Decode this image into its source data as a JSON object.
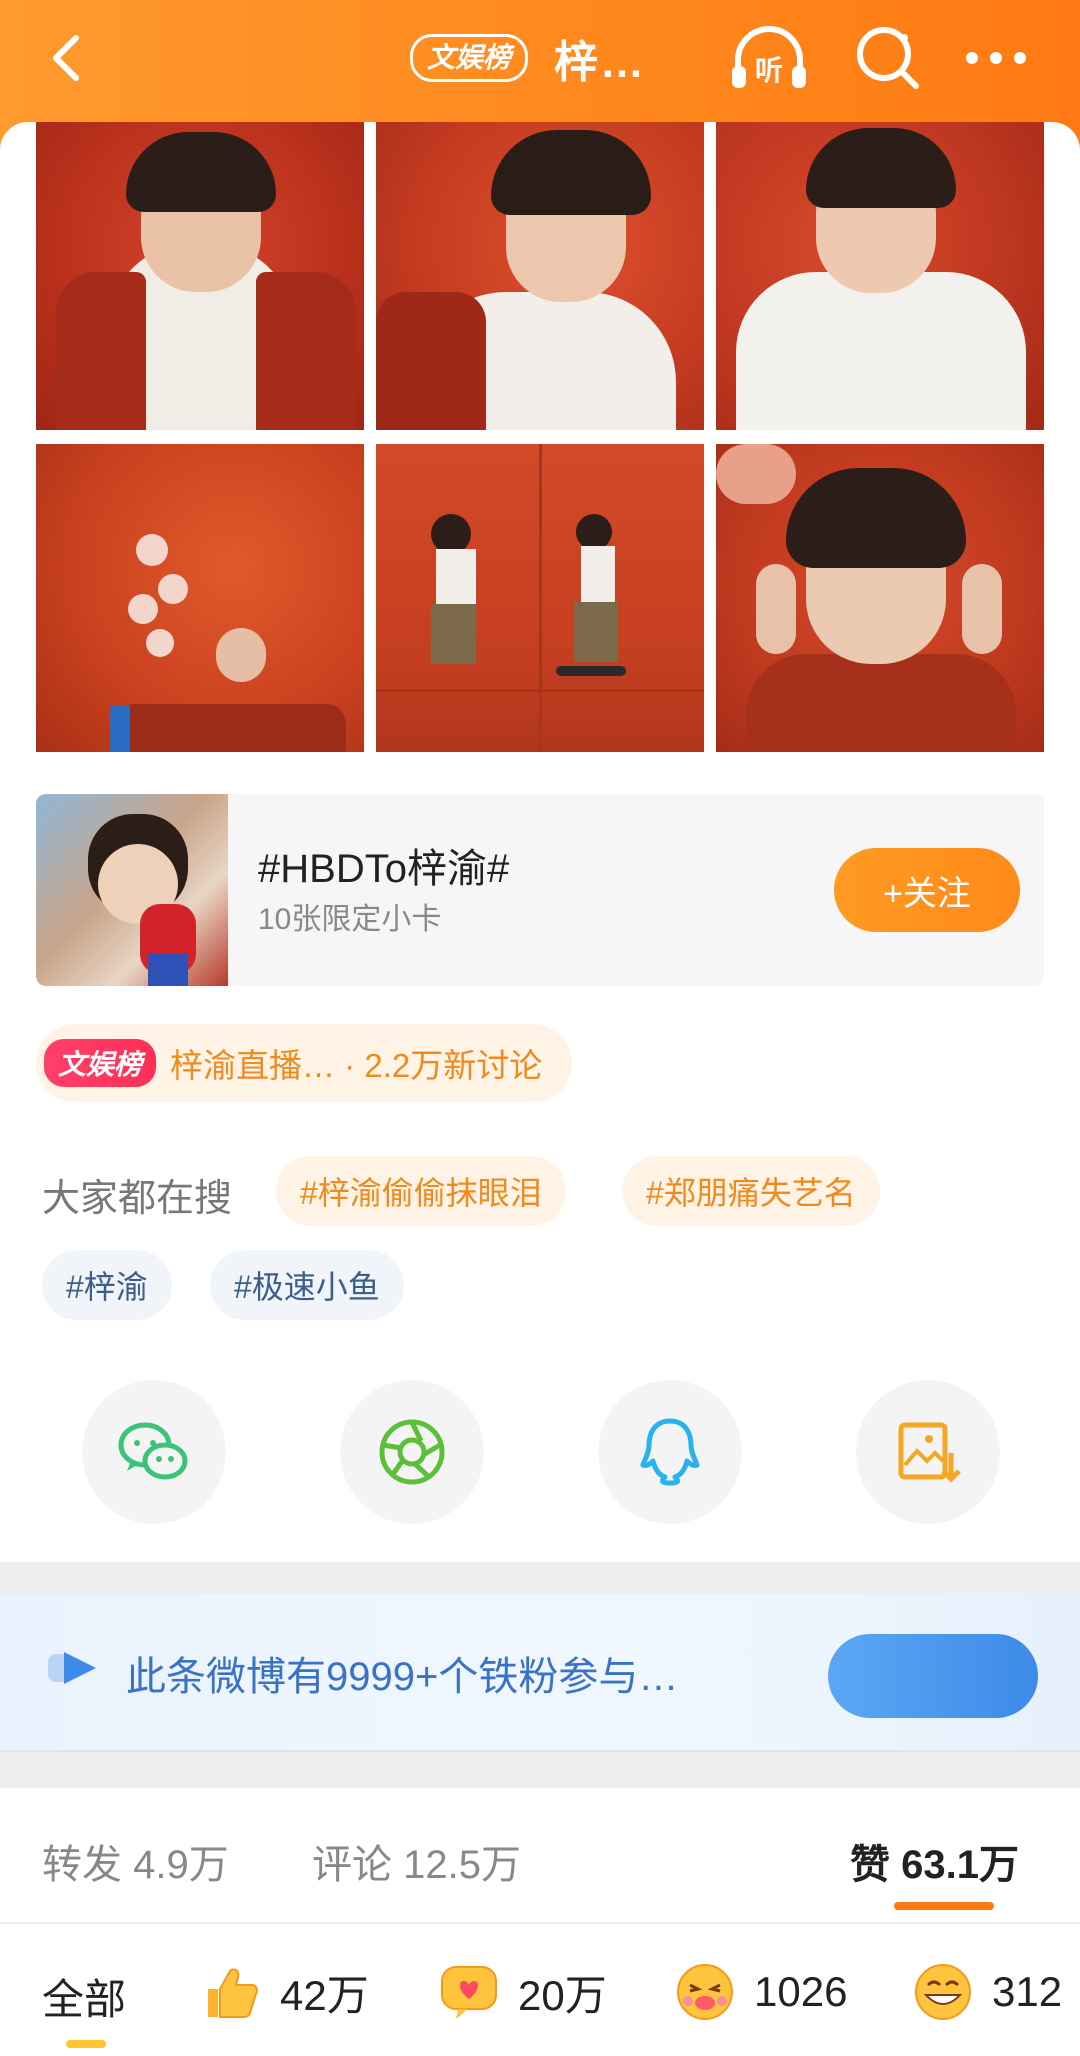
{
  "header": {
    "back_icon": "back-chevron-icon",
    "rank_tag": "文娱榜",
    "title": "梓…",
    "listen_label": "听",
    "search_icon": "search-icon",
    "more_icon": "more-dots-icon",
    "bg_color": "#ff8a1f"
  },
  "photos": {
    "count": 6
  },
  "topic": {
    "name": "#HBDTo梓渝#",
    "description": "10张限定小卡",
    "follow_label": "+关注"
  },
  "trending": {
    "badge": "文娱榜",
    "text": "梓渝直播… · 2.2万新讨论"
  },
  "search_suggestions": {
    "label": "大家都在搜",
    "tags": [
      {
        "text": "#梓渝偷偷抹眼泪",
        "style": "orange"
      },
      {
        "text": "#郑朋痛失艺名",
        "style": "orange"
      },
      {
        "text": "#梓渝",
        "style": "blue"
      },
      {
        "text": "#极速小鱼",
        "style": "blue"
      }
    ]
  },
  "share": {
    "items": [
      {
        "name": "wechat-icon",
        "color": "#3dc379"
      },
      {
        "name": "moments-icon",
        "color": "#5cbf3a"
      },
      {
        "name": "qq-icon",
        "color": "#2ab2f0"
      },
      {
        "name": "save-image-icon",
        "color": "#f5a623"
      }
    ]
  },
  "fan_banner": {
    "text": "此条微博有9999+个铁粉参与…"
  },
  "stats": {
    "repost": "转发 4.9万",
    "comment": "评论 12.5万",
    "like": "赞 63.1万"
  },
  "reactions": {
    "all_label": "全部",
    "items": [
      {
        "name": "thumbs-up-emoji-icon",
        "count": "42万"
      },
      {
        "name": "heart-bubble-emoji-icon",
        "count": "20万"
      },
      {
        "name": "kiss-emoji-icon",
        "count": "1026"
      },
      {
        "name": "grin-emoji-icon",
        "count": "312"
      }
    ]
  }
}
